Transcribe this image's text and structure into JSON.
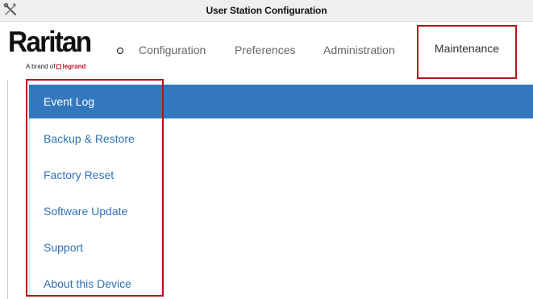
{
  "window": {
    "title": "User Station Configuration",
    "icon": "tools-icon"
  },
  "brand": {
    "logo_text": "Raritan",
    "tagline_prefix": "A brand of",
    "tagline_brand": "legrand"
  },
  "nav": {
    "items": [
      {
        "label": "Configuration"
      },
      {
        "label": "Preferences"
      },
      {
        "label": "Administration"
      },
      {
        "label": "Maintenance"
      }
    ],
    "active": "Maintenance"
  },
  "maintenance_menu": {
    "items": [
      {
        "label": "Event Log"
      },
      {
        "label": "Backup & Restore"
      },
      {
        "label": "Factory Reset"
      },
      {
        "label": "Software Update"
      },
      {
        "label": "Support"
      },
      {
        "label": "About this Device"
      }
    ],
    "active": "Event Log"
  },
  "colors": {
    "accent_blue": "#3377bd",
    "link_blue": "#2f72b5",
    "highlight_red": "#b5121b",
    "brand_red": "#c8102e"
  }
}
